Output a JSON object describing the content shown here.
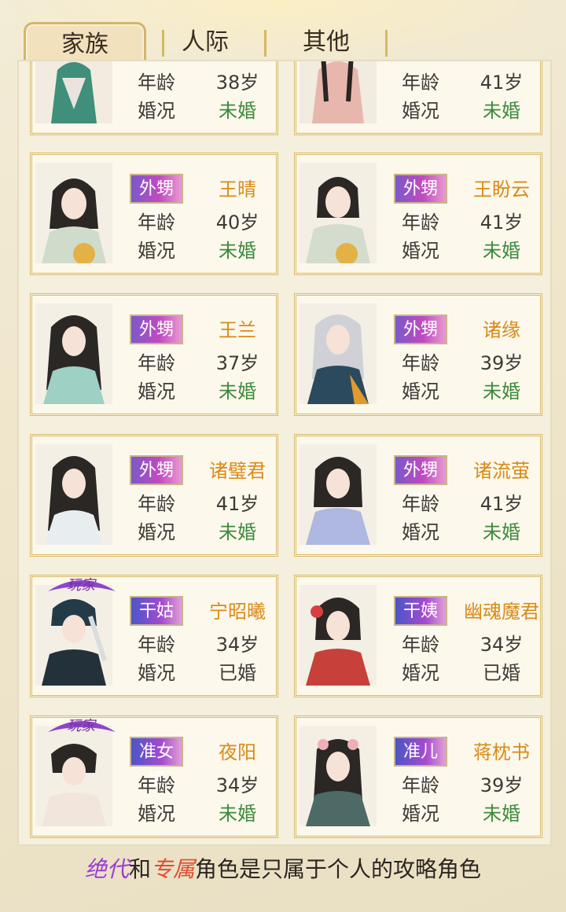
{
  "tabs": [
    {
      "label": "家族"
    },
    {
      "label": "人际"
    },
    {
      "label": "其他"
    }
  ],
  "labels": {
    "age": "年龄",
    "marital": "婚况"
  },
  "top_partial": [
    {
      "age": "38岁",
      "marital": "未婚"
    },
    {
      "age": "41岁",
      "marital": "未婚"
    }
  ],
  "cards": [
    {
      "tag": "外甥女",
      "name": "王晴",
      "age": "40岁",
      "marital": "未婚",
      "badge": ""
    },
    {
      "tag": "外甥女",
      "name": "王盼云",
      "age": "41岁",
      "marital": "未婚",
      "badge": ""
    },
    {
      "tag": "外甥女",
      "name": "王兰",
      "age": "37岁",
      "marital": "未婚",
      "badge": ""
    },
    {
      "tag": "外甥女",
      "name": "诸缘",
      "age": "39岁",
      "marital": "未婚",
      "badge": ""
    },
    {
      "tag": "外甥女",
      "name": "诸璧君",
      "age": "41岁",
      "marital": "未婚",
      "badge": ""
    },
    {
      "tag": "外甥女",
      "name": "诸流萤",
      "age": "41岁",
      "marital": "未婚",
      "badge": ""
    },
    {
      "tag": "干姑",
      "name": "宁昭曦",
      "age": "34岁",
      "marital": "已婚",
      "badge": "玩家"
    },
    {
      "tag": "干姨妈",
      "name": "幽魂魔君",
      "age": "34岁",
      "marital": "已婚",
      "badge": ""
    },
    {
      "tag": "准女婿",
      "name": "夜阳",
      "age": "34岁",
      "marital": "未婚",
      "badge": "玩家"
    },
    {
      "tag": "准儿媳",
      "name": "蒋枕书",
      "age": "39岁",
      "marital": "未婚",
      "badge": ""
    }
  ],
  "footer": {
    "part1": "绝代",
    "part2": "和",
    "part3": "专属",
    "part4": "角色是只属于个人的攻略角色"
  },
  "colors": {
    "name": "#d98a16",
    "single": "#3c8a3a",
    "married": "#3e3a36",
    "frame": "#d8b864"
  }
}
